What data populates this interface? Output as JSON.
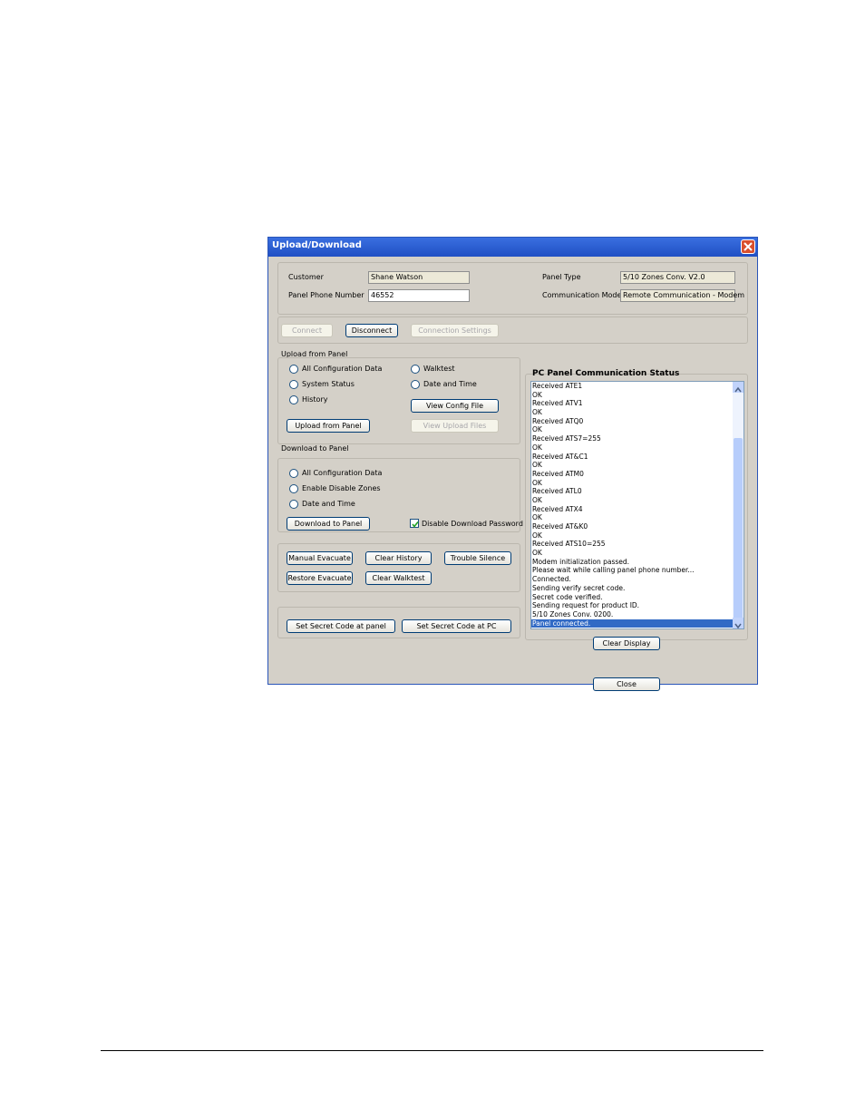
{
  "window": {
    "title": "Upload/Download"
  },
  "info": {
    "customer_label": "Customer",
    "customer_value": "Shane Watson",
    "phone_label": "Panel Phone Number",
    "phone_value": "46552",
    "panel_type_label": "Panel Type",
    "panel_type_value": "5/10 Zones Conv. V2.0",
    "comm_mode_label": "Communication Mode",
    "comm_mode_value": "Remote Communication - Modem"
  },
  "connection": {
    "connect": "Connect",
    "disconnect": "Disconnect",
    "settings": "Connection Settings"
  },
  "upload": {
    "title": "Upload from Panel",
    "options": [
      "All Configuration Data",
      "System Status",
      "History",
      "Walktest",
      "Date and Time"
    ],
    "view_config": "View Config File",
    "upload_btn": "Upload from Panel",
    "view_upload": "View Upload Files"
  },
  "download": {
    "title": "Download to Panel",
    "options": [
      "All Configuration Data",
      "Enable Disable Zones",
      "Date and Time"
    ],
    "download_btn": "Download to Panel",
    "disable_pw": "Disable Download Password"
  },
  "actions": {
    "manual_evacuate": "Manual Evacuate",
    "clear_history": "Clear History",
    "trouble_silence": "Trouble Silence",
    "restore_evacuate": "Restore Evacuate",
    "clear_walktest": "Clear Walktest"
  },
  "secret": {
    "at_panel": "Set Secret Code at panel",
    "at_pc": "Set Secret Code at PC"
  },
  "status": {
    "title": "PC Panel Communication Status",
    "lines": [
      "Received ATE1",
      "OK",
      "Received ATV1",
      "OK",
      "Received ATQ0",
      "OK",
      "Received ATS7=255",
      "OK",
      "Received AT&C1",
      "OK",
      "Received ATM0",
      "OK",
      "Received ATL0",
      "OK",
      "Received ATX4",
      "OK",
      "Received AT&K0",
      "OK",
      "Received ATS10=255",
      "OK",
      "Modem initialization passed.",
      "Please wait while calling panel phone number...",
      "Connected.",
      "Sending verify secret code.",
      "Secret code verified.",
      "Sending request for product ID.",
      "5/10 Zones Conv. 0200.",
      "Panel connected."
    ],
    "selected_index": 27,
    "clear_btn": "Clear Display"
  },
  "close_btn": "Close"
}
